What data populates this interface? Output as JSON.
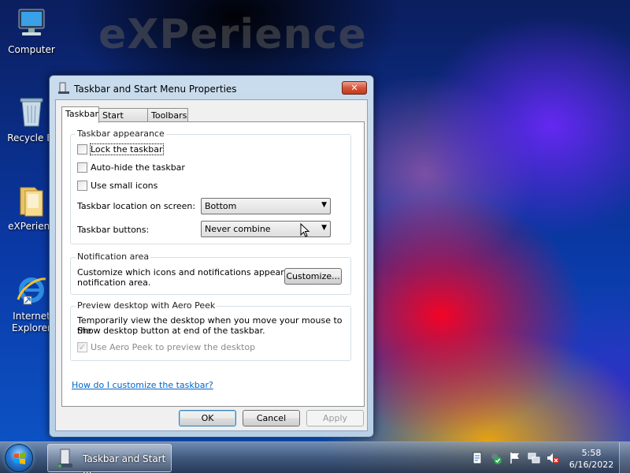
{
  "desktop": {
    "watermark": "eXPerience",
    "icons": [
      {
        "label": "Computer"
      },
      {
        "label": "Recycle Bi"
      },
      {
        "label": "eXPerienc"
      },
      {
        "label": "Internet\nExplorer",
        "line1": "Internet",
        "line2": "Explorer"
      }
    ]
  },
  "window": {
    "title": "Taskbar and Start Menu Properties",
    "close_label": "✕",
    "tabs": [
      {
        "label": "Taskbar",
        "active": true
      },
      {
        "label": "Start Menu",
        "active": false
      },
      {
        "label": "Toolbars",
        "active": false
      }
    ],
    "appearance": {
      "title": "Taskbar appearance",
      "lock": {
        "label": "Lock the taskbar",
        "checked": false
      },
      "autohide": {
        "label": "Auto-hide the taskbar",
        "checked": false
      },
      "small_icons": {
        "label": "Use small icons",
        "checked": false
      },
      "location_label": "Taskbar location on screen:",
      "location_value": "Bottom",
      "buttons_label": "Taskbar buttons:",
      "buttons_value": "Never combine"
    },
    "notification": {
      "title": "Notification area",
      "text": "Customize which icons and notifications appear in the notification area.",
      "line1": "Customize which icons and notifications appear in the",
      "line2": "notification area.",
      "customize_label": "Customize..."
    },
    "peek": {
      "title": "Preview desktop with Aero Peek",
      "line1": "Temporarily view the desktop when you move your mouse to the",
      "line2": "Show desktop button at end of the taskbar.",
      "checkbox_label": "Use Aero Peek to preview the desktop",
      "checked": true,
      "disabled": true
    },
    "help_link": "How do I customize the taskbar?",
    "ok_label": "OK",
    "cancel_label": "Cancel",
    "apply_label": "Apply"
  },
  "taskbar": {
    "task_label": "Taskbar and Start ...",
    "clock_time": "5:58",
    "clock_date": "6/16/2022",
    "tray_icons": [
      "notes-icon",
      "security-shield-icon",
      "action-center-flag-icon",
      "network-icon",
      "volume-muted-icon"
    ]
  },
  "colors": {
    "link": "#0066cc",
    "close_button": "#c13b1e"
  }
}
